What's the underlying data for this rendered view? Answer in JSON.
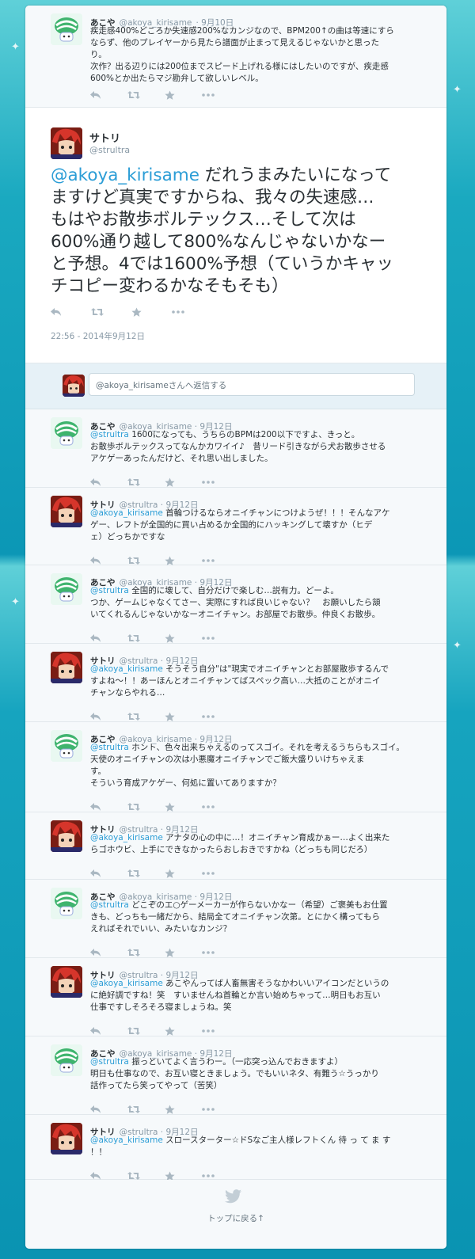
{
  "colors": {
    "accent": "#2b9dd6",
    "bg": "#0c97b6",
    "text": "#292f33",
    "muted": "#8899a6"
  },
  "top_tweet": {
    "name": "あこや",
    "handle": "@akoya_kirisame",
    "date": "9月10日",
    "lines": [
      "疾走感400%どころか失速感200%なカンジなので、BPM200↑の曲は等速にすら",
      "ならず、他のプレイヤーから見たら譜面が止まって見えるじゃないかと思った",
      "り。",
      "次作？出る辺りには200位までスピード上げれる様にはしたいのですが、疾走感",
      "600%とか出たらマジ勘弁して欲しいレベル。"
    ]
  },
  "main_tweet": {
    "name": "サトリ",
    "handle": "@strultra",
    "mention": "@akoya_kirisame",
    "lines": [
      " だれうまみたいになって",
      "ますけど真実ですからね、我々の失速感…",
      "もはやお散歩ボルテックス…そして次は",
      "600%通り越して800%なんじゃないかなー",
      "と予想。4では1600%予想（ていうかキャッ",
      "チコピー変わるかなそもそも）"
    ],
    "time": "22:56 - 2014年9月12日"
  },
  "reply_placeholder": "@akoya_kirisameさんへ返信する",
  "replies": [
    {
      "name": "あこや",
      "handle": "@akoya_kirisame",
      "date": "9月12日",
      "mention": "@strultra",
      "lines": [
        " 1600になっても、うちらのBPMは200以下ですよ、きっと。",
        "お散歩ボルテックスってなんかカワイイ♪　昔リード引きながら犬お散歩させる",
        "アケゲーあったんだけど、それ思い出しました。"
      ]
    },
    {
      "name": "サトリ",
      "handle": "@strultra",
      "date": "9月12日",
      "mention": "@akoya_kirisame",
      "lines": [
        " 首輪つけるならオニイチャンにつけようぜ！！！そんなアケ",
        "ゲー、レフトが全国的に買い占めるか全国的にハッキングして壊すか（ヒデ",
        "ェ）どっちかですな"
      ]
    },
    {
      "name": "あこや",
      "handle": "@akoya_kirisame",
      "date": "9月12日",
      "mention": "@strultra",
      "lines": [
        " 全国的に壊して、自分だけで楽しむ…説有力。どーよ。",
        "つか、ゲームじゃなくてさー、実際にすれば良いじゃない？　お願いしたら頷",
        "いてくれるんじゃないかなーオニイチャン。お部屋でお散歩。仲良くお散歩。"
      ]
    },
    {
      "name": "サトリ",
      "handle": "@strultra",
      "date": "9月12日",
      "mention": "@akoya_kirisame",
      "lines": [
        " そうそう自分\"は\"現実でオニイチャンとお部屋散歩するんで",
        "すよね〜！！あーほんとオニイチャンてばスペック高い…大抵のことがオニイ",
        "チャンならやれる…"
      ]
    },
    {
      "name": "あこや",
      "handle": "@akoya_kirisame",
      "date": "9月12日",
      "mention": "@strultra",
      "lines": [
        " ホント、色々出来ちゃえるのってスゴイ。それを考えるうちらもスゴイ。",
        "天使のオニイチャンの次は小悪魔オニイチャンでご飯大盛りいけちゃえま",
        "す。",
        "そういう育成アケゲー、何処に置いてありますか？"
      ]
    },
    {
      "name": "サトリ",
      "handle": "@strultra",
      "date": "9月12日",
      "mention": "@akoya_kirisame",
      "lines": [
        " アナタの心の中に…！オニイチャン育成かぁー…よく出来た",
        "らゴホウビ、上手にできなかったらおしおきですかね（どっちも同じだろ）"
      ]
    },
    {
      "name": "あこや",
      "handle": "@akoya_kirisame",
      "date": "9月12日",
      "mention": "@strultra",
      "lines": [
        " どこぞのエ○ゲーメーカーが作らないかなー（希望）ご褒美もお仕置",
        "きも、どっちも一緒だから、結局全てオニイチャン次第。とにかく構ってもら",
        "えればそれでいい、みたいなカンジ？"
      ]
    },
    {
      "name": "サトリ",
      "handle": "@strultra",
      "date": "9月12日",
      "mention": "@akoya_kirisame",
      "lines": [
        " あこやんってば人畜無害そうなかわいいアイコンだというの",
        "に絶好調ですね！笑　すいませんね首輪とか言い始めちゃって…明日もお互い",
        "仕事ですしそろそろ寝ましょうね。笑"
      ]
    },
    {
      "name": "あこや",
      "handle": "@akoya_kirisame",
      "date": "9月12日",
      "mention": "@strultra",
      "lines": [
        " 振っといてよく言うわー。（一応突っ込んでおきますよ）",
        "明日も仕事なので、お互い寝ときましょう。でもいいネタ、有難う☆うっかり",
        "話作ってたら笑ってやって（苦笑）"
      ]
    },
    {
      "name": "サトリ",
      "handle": "@strultra",
      "date": "9月12日",
      "mention": "@akoya_kirisame",
      "lines": [
        " スロースターター☆ドSなご主人様レフトくん 待 っ て ま す",
        "！！"
      ]
    }
  ],
  "footer": {
    "top_link": "トップに戻る↑"
  },
  "icons": [
    "reply-icon",
    "retweet-icon",
    "favorite-icon",
    "more-icon",
    "twitter-bird-icon"
  ]
}
